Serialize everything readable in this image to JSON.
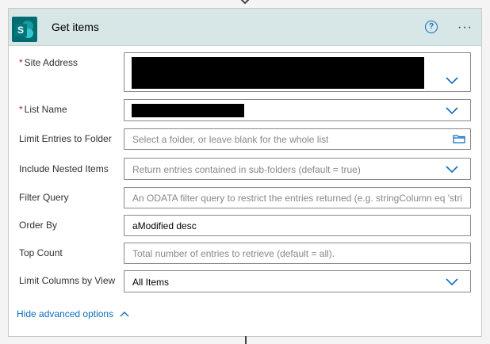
{
  "action": {
    "title": "Get items",
    "app_icon_letter": "S",
    "help_glyph": "?",
    "more_glyph": "···",
    "required_mark": "*"
  },
  "fields": {
    "site_address": {
      "label": "Site Address",
      "required": true,
      "value_redacted": true
    },
    "list_name": {
      "label": "List Name",
      "required": true,
      "value_redacted": true
    },
    "limit_folder": {
      "label": "Limit Entries to Folder",
      "placeholder": "Select a folder, or leave blank for the whole list"
    },
    "nested": {
      "label": "Include Nested Items",
      "placeholder": "Return entries contained in sub-folders (default = true)"
    },
    "filter": {
      "label": "Filter Query",
      "placeholder": "An ODATA filter query to restrict the entries returned (e.g. stringColumn eq 'stri"
    },
    "order": {
      "label": "Order By",
      "value": "aModified desc"
    },
    "top": {
      "label": "Top Count",
      "placeholder": "Total number of entries to retrieve (default = all)."
    },
    "view": {
      "label": "Limit Columns by View",
      "value": "All Items"
    }
  },
  "advanced_toggle": "Hide advanced options",
  "colors": {
    "accent": "#0f6cbd",
    "header": "#d7e6e6",
    "sharepoint": "#036c70",
    "required": "#a4262c"
  },
  "icons": [
    "sharepoint-icon",
    "help-icon",
    "more-icon",
    "chevron-down-icon",
    "folder-icon",
    "chevron-up-icon"
  ]
}
